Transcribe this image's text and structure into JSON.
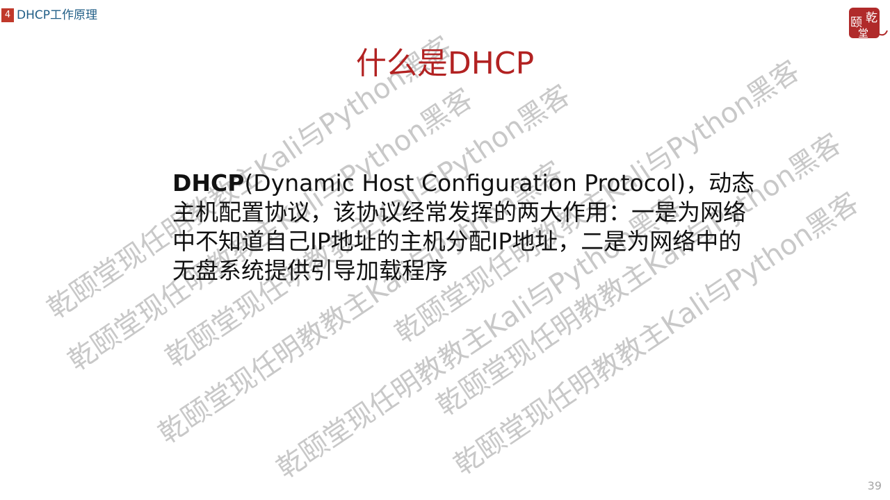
{
  "header": {
    "section_number": "4",
    "section_title": "DHCP工作原理"
  },
  "logo": {
    "chars": [
      "颐",
      "乾",
      "堂"
    ]
  },
  "slide": {
    "title": "什么是DHCP",
    "body_bold": "DHCP",
    "body_rest": "(Dynamic Host Configuration Protocol)，动态主机配置协议，该协议经常发挥的两大作用：一是为网络中不知道自己IP地址的主机分配IP地址，二是为网络中的无盘系统提供引导加载程序"
  },
  "watermark": {
    "line_a": "乾颐堂现任明教教主Kali与Python黑客",
    "line_b": "乾颐堂现任明教教主Kali与Python黑客"
  },
  "page_number": "39",
  "colors": {
    "title": "#b22222",
    "header_text": "#1f5d86",
    "badge": "#c0392b",
    "seal": "#b02a2a"
  }
}
